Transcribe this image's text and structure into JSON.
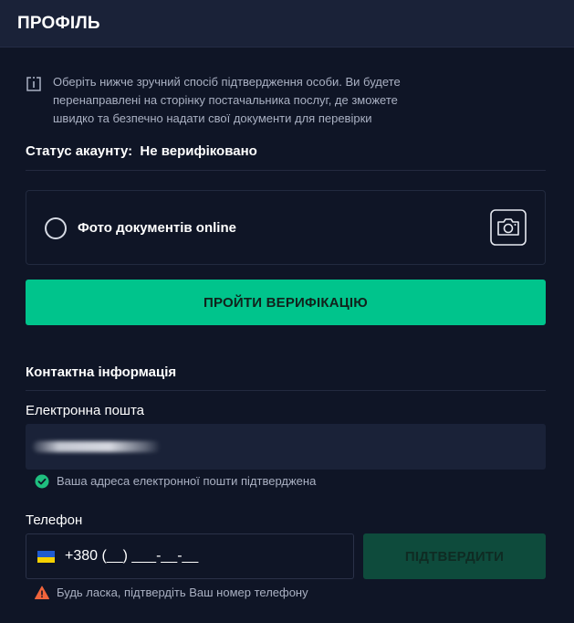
{
  "header": {
    "title": "ПРОФІЛЬ"
  },
  "info": {
    "icon": "info-icon",
    "line1": "Оберіть нижче зручний спосіб підтвердження особи. Ви будете",
    "line2": "перенаправлені на сторінку постачальника послуг, де зможете",
    "line3": "швидко та безпечно надати свої документи для перевірки"
  },
  "status": {
    "label": "Статус акаунту:",
    "value": "Не верифіковано"
  },
  "verification_option": {
    "label": "Фото документів online",
    "icon": "camera-icon",
    "selected": false
  },
  "verify_button": {
    "label": "ПРОЙТИ ВЕРИФІКАЦІЮ",
    "color": "#00c48c"
  },
  "contact": {
    "title": "Контактна інформація",
    "email": {
      "label": "Електронна пошта",
      "hint": "Ваша адреса електронної пошти підтверджена",
      "hint_icon": "check-circle-icon",
      "hint_color": "#1fbf7f"
    },
    "phone": {
      "label": "Телефон",
      "value": "+380 (__) ___-__-__",
      "flag": "ukraine-flag-icon",
      "confirm_label": "ПІДТВЕРДИТИ",
      "hint": "Будь ласка, підтвердіть Ваш номер телефону",
      "hint_icon": "warning-icon",
      "hint_color": "#f0643c"
    }
  },
  "colors": {
    "background": "#0f1526",
    "panel": "#1a2238",
    "accent": "#00c48c"
  }
}
